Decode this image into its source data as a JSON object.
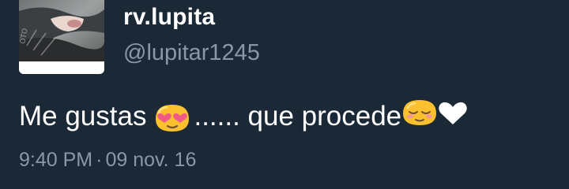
{
  "user": {
    "display_name": "rv.lupita",
    "handle": "@lupitar1245"
  },
  "tweet": {
    "text_before": "Me gustas ",
    "text_middle": "...... que procede",
    "emojis": [
      "heart-eyes-emoji",
      "blush-emoji",
      "white-heart-emoji"
    ]
  },
  "meta": {
    "time": "9:40 PM",
    "separator": "·",
    "date": "09 nov. 16"
  },
  "colors": {
    "background": "#1b2836",
    "text": "#ffffff",
    "secondary_text": "#8899a6",
    "emoji_yellow": "#fbc02d",
    "heart_pink": "#ef5a86"
  }
}
